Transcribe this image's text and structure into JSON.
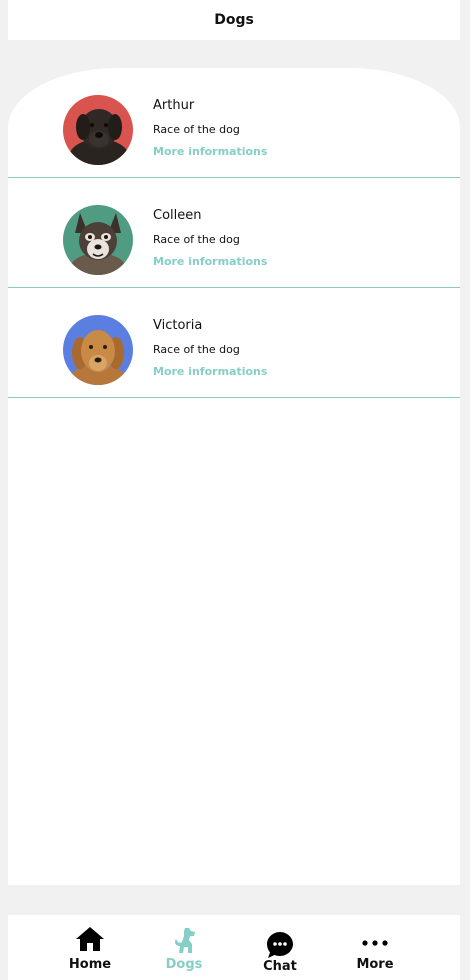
{
  "header": {
    "title": "Dogs"
  },
  "dogs": [
    {
      "name": "Arthur",
      "race": "Race of the dog",
      "more": "More informations",
      "avatar_bg": "#d9534f",
      "dog_color": "#2a2421",
      "avatar_icon": "black-labrador-photo"
    },
    {
      "name": "Colleen",
      "race": "Race of the dog",
      "more": "More informations",
      "avatar_bg": "#4f9c82",
      "dog_color": "#5a4c42",
      "avatar_icon": "husky-photo"
    },
    {
      "name": "Victoria",
      "race": "Race of the dog",
      "more": "More informations",
      "avatar_bg": "#5b7fe0",
      "dog_color": "#c98a45",
      "avatar_icon": "golden-retriever-photo"
    }
  ],
  "nav": {
    "items": [
      {
        "label": "Home",
        "icon": "home-icon"
      },
      {
        "label": "Dogs",
        "icon": "dog-icon",
        "active": true
      },
      {
        "label": "Chat",
        "icon": "chat-icon"
      },
      {
        "label": "More",
        "icon": "more-icon"
      }
    ]
  },
  "colors": {
    "accent": "#86cfc7",
    "divider": "#8cc9c3",
    "background": "#f1f1f1"
  }
}
